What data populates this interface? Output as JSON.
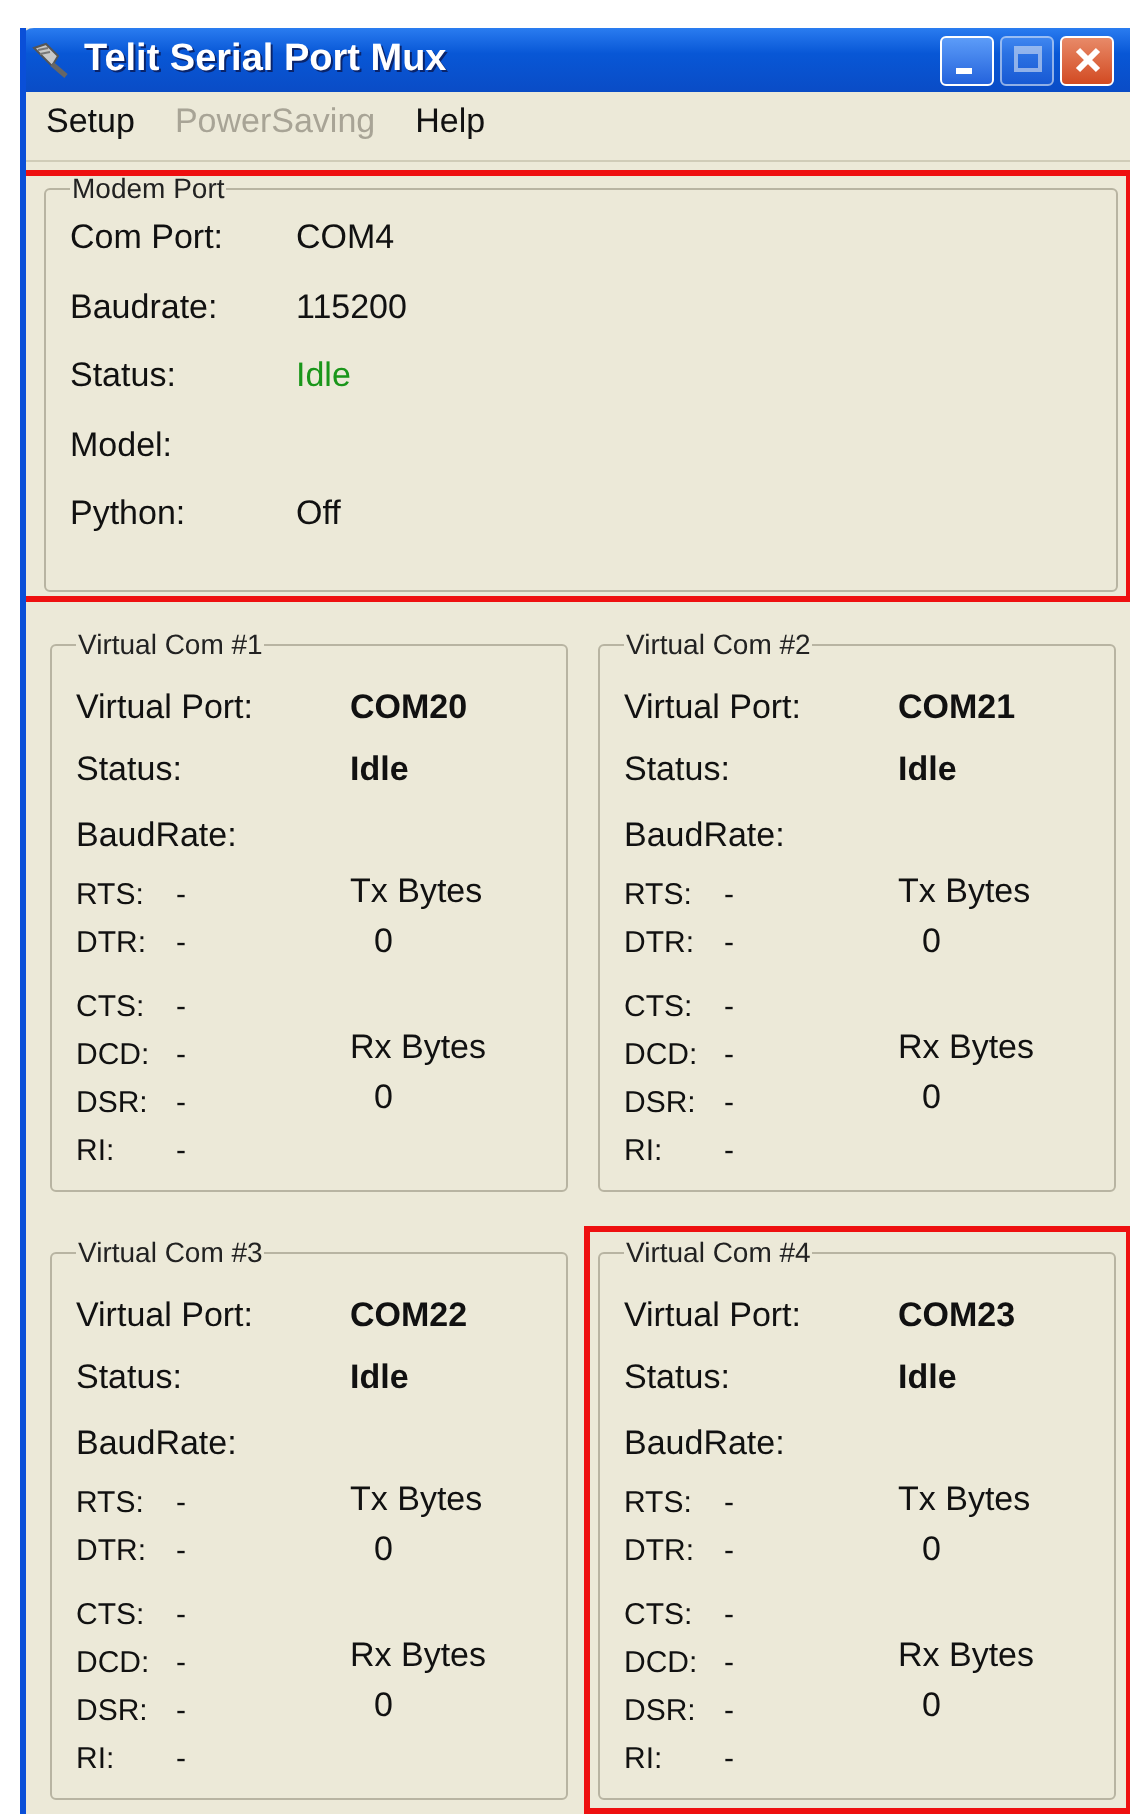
{
  "window": {
    "title": "Telit Serial Port Mux",
    "controls": [
      {
        "kind": "minimize",
        "disabled": false
      },
      {
        "kind": "maximize",
        "disabled": true
      },
      {
        "kind": "close",
        "disabled": false
      }
    ]
  },
  "menu": [
    {
      "label": "Setup",
      "disabled": false
    },
    {
      "label": "PowerSaving",
      "disabled": true
    },
    {
      "label": "Help",
      "disabled": false
    }
  ],
  "modem_port": {
    "title": "Modem Port",
    "highlighted": true,
    "fields": [
      {
        "label": "Com Port:",
        "value": "COM4"
      },
      {
        "label": "Baudrate:",
        "value": "115200"
      },
      {
        "label": "Status:",
        "value": "Idle",
        "color": "#1a961a"
      },
      {
        "label": "Model:"
      },
      {
        "label": "Python:",
        "value": "Off"
      }
    ]
  },
  "virtual_coms": [
    {
      "title": "Virtual Com #1",
      "highlighted": false,
      "port_label": "Virtual Port:",
      "port": "COM20",
      "status_label": "Status:",
      "status": "Idle",
      "baudrate_label": "BaudRate:",
      "signal_groups": [
        [
          {
            "label": "RTS:",
            "value": "-"
          },
          {
            "label": "DTR:",
            "value": "-"
          }
        ],
        [
          {
            "label": "CTS:",
            "value": "-"
          },
          {
            "label": "DCD:",
            "value": "-"
          },
          {
            "label": "DSR:",
            "value": "-"
          },
          {
            "label": "RI:",
            "value": "-"
          }
        ]
      ],
      "tx_label": "Tx Bytes",
      "tx": "0",
      "rx_label": "Rx Bytes",
      "rx": "0"
    },
    {
      "title": "Virtual Com #2",
      "highlighted": false,
      "port_label": "Virtual Port:",
      "port": "COM21",
      "status_label": "Status:",
      "status": "Idle",
      "baudrate_label": "BaudRate:",
      "signal_groups": [
        [
          {
            "label": "RTS:",
            "value": "-"
          },
          {
            "label": "DTR:",
            "value": "-"
          }
        ],
        [
          {
            "label": "CTS:",
            "value": "-"
          },
          {
            "label": "DCD:",
            "value": "-"
          },
          {
            "label": "DSR:",
            "value": "-"
          },
          {
            "label": "RI:",
            "value": "-"
          }
        ]
      ],
      "tx_label": "Tx Bytes",
      "tx": "0",
      "rx_label": "Rx Bytes",
      "rx": "0"
    },
    {
      "title": "Virtual Com #3",
      "highlighted": false,
      "port_label": "Virtual Port:",
      "port": "COM22",
      "status_label": "Status:",
      "status": "Idle",
      "baudrate_label": "BaudRate:",
      "signal_groups": [
        [
          {
            "label": "RTS:",
            "value": "-"
          },
          {
            "label": "DTR:",
            "value": "-"
          }
        ],
        [
          {
            "label": "CTS:",
            "value": "-"
          },
          {
            "label": "DCD:",
            "value": "-"
          },
          {
            "label": "DSR:",
            "value": "-"
          },
          {
            "label": "RI:",
            "value": "-"
          }
        ]
      ],
      "tx_label": "Tx Bytes",
      "tx": "0",
      "rx_label": "Rx Bytes",
      "rx": "0"
    },
    {
      "title": "Virtual Com #4",
      "highlighted": true,
      "port_label": "Virtual Port:",
      "port": "COM23",
      "status_label": "Status:",
      "status": "Idle",
      "baudrate_label": "BaudRate:",
      "signal_groups": [
        [
          {
            "label": "RTS:",
            "value": "-"
          },
          {
            "label": "DTR:",
            "value": "-"
          }
        ],
        [
          {
            "label": "CTS:",
            "value": "-"
          },
          {
            "label": "DCD:",
            "value": "-"
          },
          {
            "label": "DSR:",
            "value": "-"
          },
          {
            "label": "RI:",
            "value": "-"
          }
        ]
      ],
      "tx_label": "Tx Bytes",
      "tx": "0",
      "rx_label": "Rx Bytes",
      "rx": "0"
    }
  ]
}
